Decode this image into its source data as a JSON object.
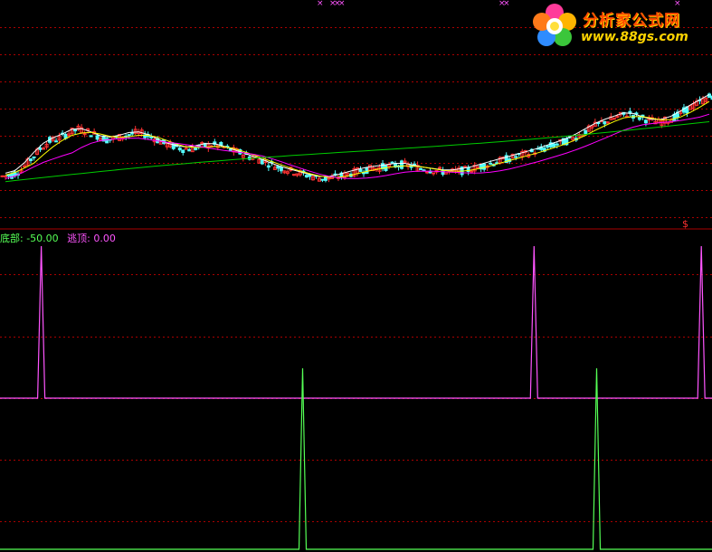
{
  "legend": {
    "bottom_label": "底部: -50.00",
    "bottom_color": "#55ff55",
    "top_label": "逃顶: 0.00",
    "top_color": "#ff55ff"
  },
  "marker_glyph": "×",
  "dollar_glyph": "$",
  "watermark": {
    "line1": "分析家公式网",
    "line2": "www.88gs.com"
  },
  "colors": {
    "background": "#000000",
    "separator": "#aa0000",
    "grid": "#aa0000",
    "up_candle": "#ff3232",
    "down_candle": "#54ffff",
    "ma_short": "#ffffff",
    "ma_mid": "#ffff00",
    "ma_long": "#ff00ff",
    "ma_longest": "#00cc00",
    "signal_top": "#ff55ff",
    "signal_bottom": "#55ff55"
  },
  "chart_data": [
    {
      "type": "candlestick",
      "description_units": "price panel without printed axis values; data given on relative price scale 0-100",
      "series_names": [],
      "close": [
        38,
        42,
        50,
        58,
        64,
        66,
        70,
        73,
        71,
        68,
        65,
        66,
        68,
        70,
        69,
        66,
        62,
        60,
        58,
        58,
        60,
        61,
        60,
        57,
        55,
        52,
        50,
        47,
        44,
        42,
        40,
        38,
        36,
        35,
        36,
        38,
        40,
        42,
        43,
        44,
        45,
        46,
        45,
        43,
        42,
        41,
        40,
        41,
        42,
        44,
        46,
        48,
        50,
        52,
        54,
        56,
        58,
        61,
        63,
        66,
        70,
        74,
        78,
        80,
        83,
        85,
        82,
        80,
        78,
        80,
        83,
        88,
        92,
        96,
        100
      ],
      "signals": {
        "top_spikes": [
          true,
          false,
          false,
          false,
          false,
          false,
          false,
          false,
          false,
          false,
          false,
          false,
          false,
          false,
          false,
          false,
          false,
          false,
          false,
          false,
          false,
          false,
          false,
          false,
          false,
          false,
          false,
          false,
          false,
          false,
          false,
          false,
          false,
          false,
          false,
          false,
          false,
          false,
          false,
          false,
          false,
          false,
          false,
          false,
          false,
          false,
          false,
          false,
          false,
          false,
          false,
          false,
          false,
          false,
          false,
          false,
          false,
          false,
          false,
          false,
          false,
          false,
          false,
          false,
          false,
          false,
          false,
          false,
          false,
          false,
          false,
          false,
          false,
          false,
          true
        ],
        "top_spike_x_fraction": [
          0.058,
          0.75,
          0.985
        ],
        "bottom_spike_x_fraction": [
          0.425,
          0.838
        ],
        "top_values": [
          0,
          100
        ],
        "bottom_values": [
          -50,
          0
        ]
      }
    }
  ]
}
